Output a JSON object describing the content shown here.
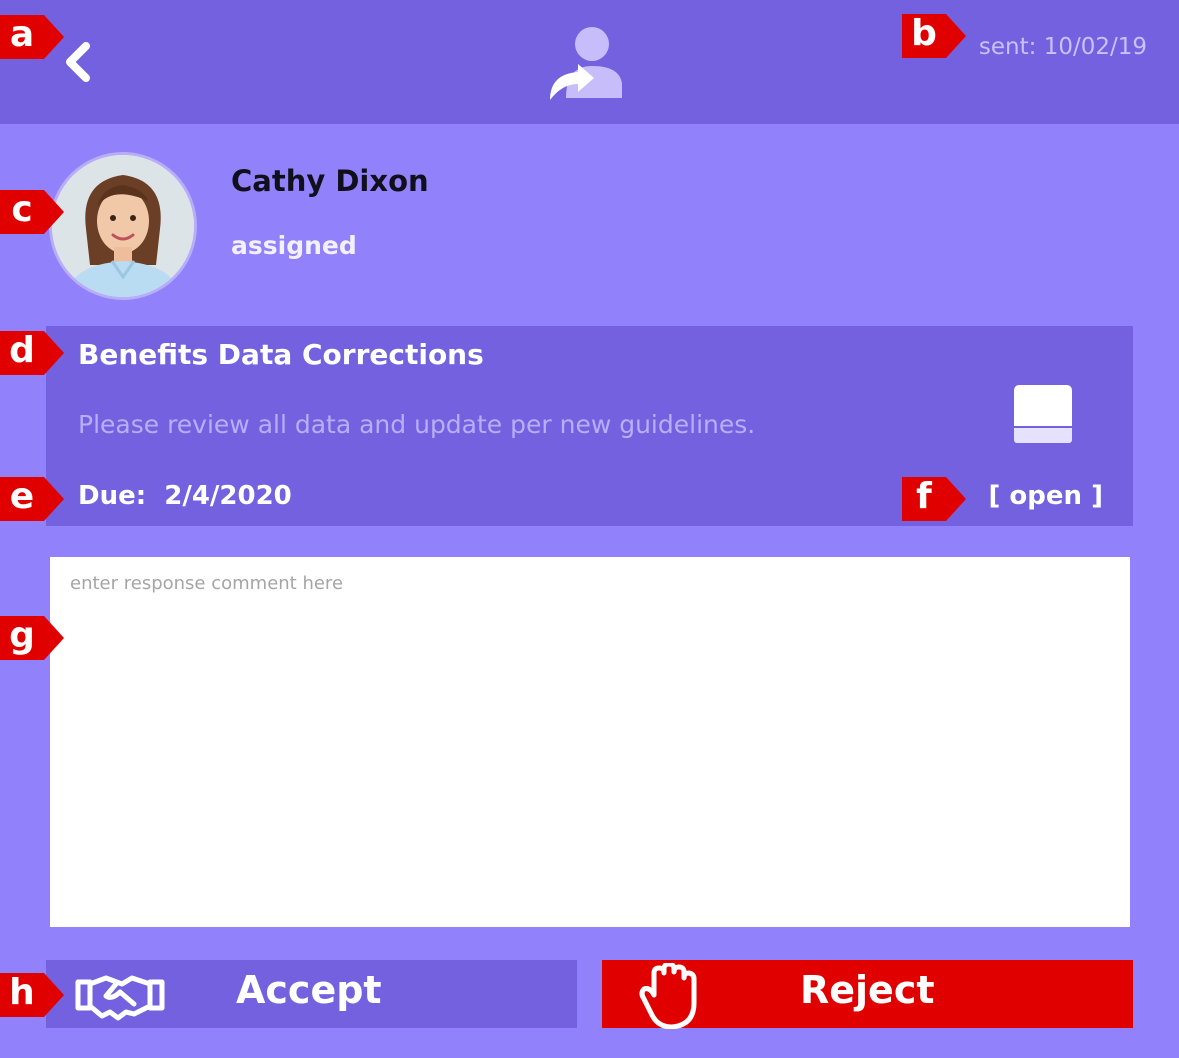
{
  "header": {
    "back_icon": "chevron-left-icon",
    "assign_icon": "user-forward-icon",
    "sent_text": "sent: 10/02/19"
  },
  "assignee": {
    "name": "Cathy Dixon",
    "status": "assigned"
  },
  "task": {
    "title": "Benefits Data Corrections",
    "description": "Please review all data and update per new guidelines.",
    "due_text": "Due:  2/4/2020",
    "status_text": "[ open ]",
    "book_icon": "book-icon"
  },
  "comment": {
    "placeholder": "enter response comment here"
  },
  "actions": {
    "accept_label": "Accept",
    "accept_icon": "handshake-icon",
    "reject_label": "Reject",
    "reject_icon": "raised-hand-icon"
  },
  "markers": [
    "a",
    "b",
    "c",
    "d",
    "e",
    "f",
    "g",
    "h"
  ],
  "colors": {
    "background": "#9181fb",
    "panel": "#7461e0",
    "reject": "#e00000",
    "marker": "#e00000"
  }
}
